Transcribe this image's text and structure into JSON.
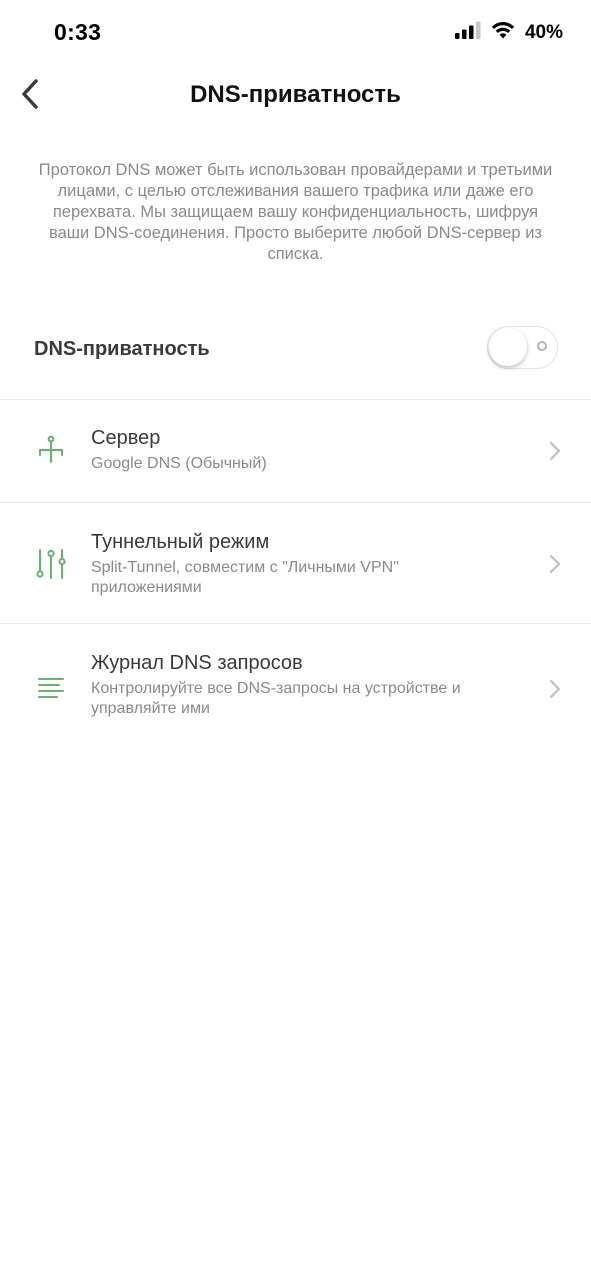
{
  "status_bar": {
    "time": "0:33",
    "battery": "40%",
    "signal_icon": "cellular-signal-icon",
    "wifi_icon": "wifi-icon"
  },
  "header": {
    "title": "DNS-приватность",
    "back_icon": "chevron-left-icon"
  },
  "description": "Протокол DNS может быть использован провайдерами и третьими лицами, с целью отслеживания вашего трафика или даже его перехвата. Мы защищаем вашу конфиденциальность, шифруя ваши DNS-соединения. Просто выберите любой DNS-сервер из списка.",
  "toggle": {
    "label": "DNS-приватность",
    "enabled": false
  },
  "items": [
    {
      "title": "Сервер",
      "subtitle": "Google DNS (Обычный)",
      "icon": "server-network-icon"
    },
    {
      "title": "Туннельный режим",
      "subtitle": "Split-Tunnel, совместим с \"Личными VPN\" приложениями",
      "icon": "sliders-icon"
    },
    {
      "title": "Журнал DNS запросов",
      "subtitle": "Контролируйте все DNS-запросы на устройстве и управляйте ими",
      "icon": "list-lines-icon"
    }
  ],
  "colors": {
    "accent": "#67b26f",
    "text": "#3a3a3a",
    "muted": "#8a8a8a",
    "divider": "#e6e6e6"
  }
}
